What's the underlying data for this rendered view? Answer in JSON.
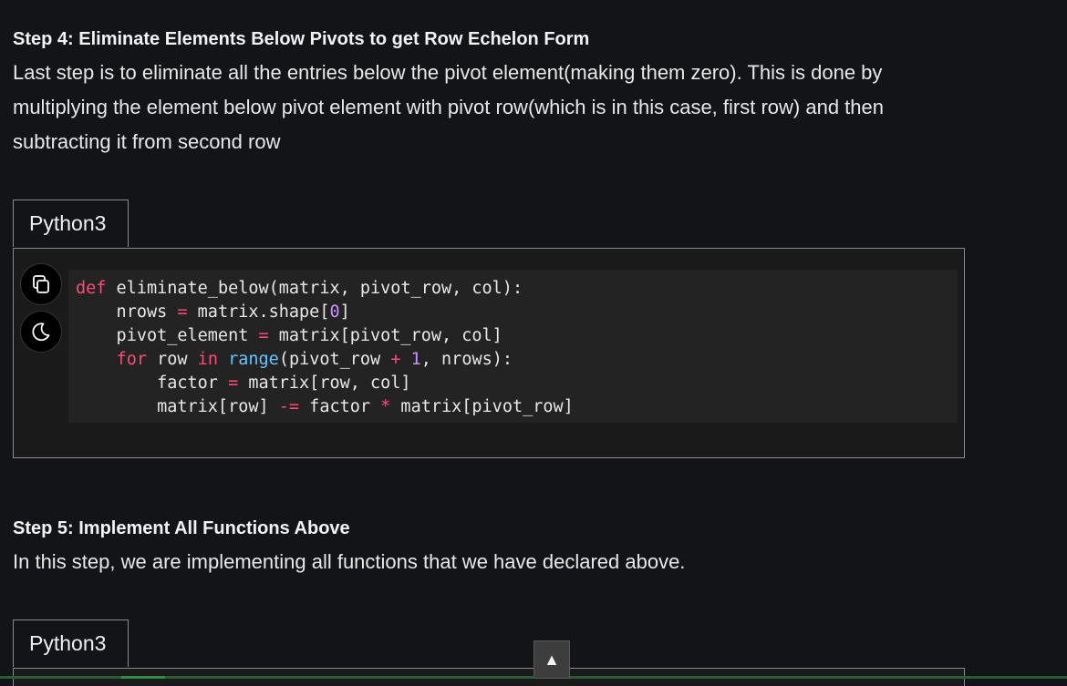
{
  "step4": {
    "title": "Step 4: Eliminate Elements Below Pivots to get Row Echelon Form",
    "text": "Last step is to eliminate all the entries below the pivot element(making them zero). This is done by multiplying the element below pivot element with pivot row(which is in this case, first row) and then subtracting it from second row",
    "tab_label": "Python3",
    "code": {
      "line1": {
        "kw": "def",
        "rest": " eliminate_below(matrix, pivot_row, col):"
      },
      "line2": {
        "a": "    nrows ",
        "op": "=",
        "b": " matrix.shape[",
        "num": "0",
        "c": "]"
      },
      "line3": {
        "a": "    pivot_element ",
        "op": "=",
        "b": " matrix[pivot_row, col]"
      },
      "line4": {
        "kw1": "for",
        "a": " row ",
        "kw2": "in",
        "bi": "range",
        "b": "(pivot_row ",
        "op": "+",
        "num": "1",
        "c": ", nrows):"
      },
      "line5": {
        "a": "        factor ",
        "op": "=",
        "b": " matrix[row, col]"
      },
      "line6": {
        "a": "        matrix[row] ",
        "op": "-=",
        "b": " factor ",
        "op2": "*",
        "c": " matrix[pivot_row]"
      }
    }
  },
  "step5": {
    "title": "Step 5: Implement All Functions Above",
    "text": "In this step, we are implementing all functions that we have declared above.",
    "tab_label": "Python3"
  },
  "icons": {
    "copy": "copy-icon",
    "theme": "moon-icon",
    "scroll_top": "arrow-up-icon"
  },
  "scroll_top_glyph": "▲"
}
